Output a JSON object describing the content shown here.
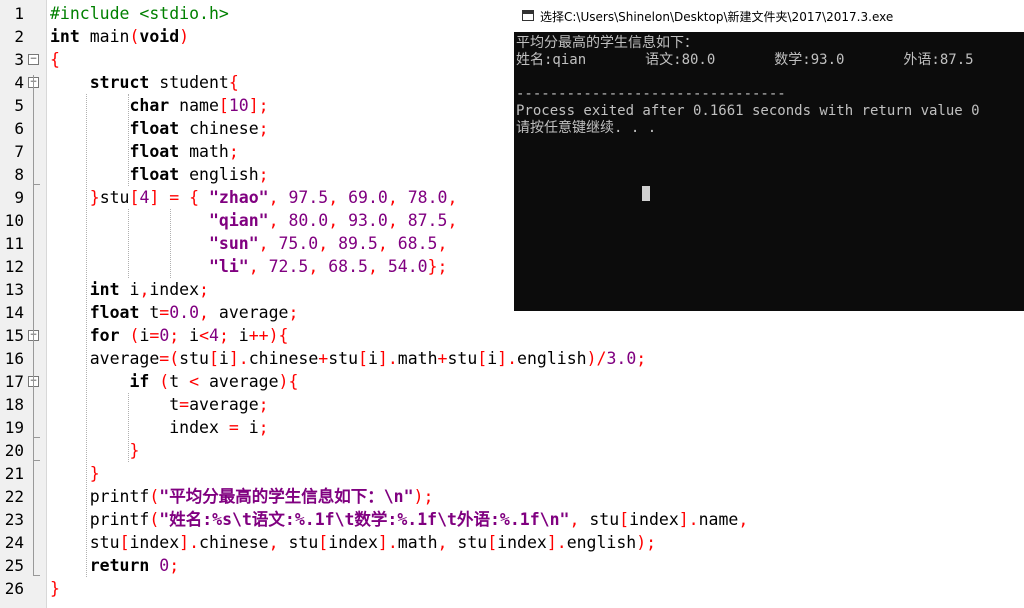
{
  "editor": {
    "line_numbers": [
      "1",
      "2",
      "3",
      "4",
      "5",
      "6",
      "7",
      "8",
      "9",
      "10",
      "11",
      "12",
      "13",
      "14",
      "15",
      "16",
      "17",
      "18",
      "19",
      "20",
      "21",
      "22",
      "23",
      "24",
      "25",
      "26"
    ],
    "lines": [
      [
        {
          "t": "#include <stdio.h>",
          "c": "pp"
        }
      ],
      [
        {
          "t": "int",
          "c": "kw"
        },
        {
          "t": " main"
        },
        {
          "t": "(",
          "c": "pn"
        },
        {
          "t": "void",
          "c": "kw"
        },
        {
          "t": ")",
          "c": "pn"
        }
      ],
      [
        {
          "t": "{",
          "c": "pn"
        }
      ],
      [
        {
          "t": "    "
        },
        {
          "t": "struct",
          "c": "kw"
        },
        {
          "t": " student"
        },
        {
          "t": "{",
          "c": "pn"
        }
      ],
      [
        {
          "t": "        "
        },
        {
          "t": "char",
          "c": "kw"
        },
        {
          "t": " name"
        },
        {
          "t": "[",
          "c": "pn"
        },
        {
          "t": "10",
          "c": "nm"
        },
        {
          "t": "];",
          "c": "pn"
        }
      ],
      [
        {
          "t": "        "
        },
        {
          "t": "float",
          "c": "kw"
        },
        {
          "t": " chinese"
        },
        {
          "t": ";",
          "c": "pn"
        }
      ],
      [
        {
          "t": "        "
        },
        {
          "t": "float",
          "c": "kw"
        },
        {
          "t": " math"
        },
        {
          "t": ";",
          "c": "pn"
        }
      ],
      [
        {
          "t": "        "
        },
        {
          "t": "float",
          "c": "kw"
        },
        {
          "t": " english"
        },
        {
          "t": ";",
          "c": "pn"
        }
      ],
      [
        {
          "t": "    "
        },
        {
          "t": "}",
          "c": "pn"
        },
        {
          "t": "stu"
        },
        {
          "t": "[",
          "c": "pn"
        },
        {
          "t": "4",
          "c": "nm"
        },
        {
          "t": "]",
          "c": "pn"
        },
        {
          "t": " "
        },
        {
          "t": "=",
          "c": "pn"
        },
        {
          "t": " "
        },
        {
          "t": "{",
          "c": "pn"
        },
        {
          "t": " "
        },
        {
          "t": "\"zhao\"",
          "c": "st"
        },
        {
          "t": ",",
          "c": "pn"
        },
        {
          "t": " "
        },
        {
          "t": "97.5",
          "c": "nm"
        },
        {
          "t": ",",
          "c": "pn"
        },
        {
          "t": " "
        },
        {
          "t": "69.0",
          "c": "nm"
        },
        {
          "t": ",",
          "c": "pn"
        },
        {
          "t": " "
        },
        {
          "t": "78.0",
          "c": "nm"
        },
        {
          "t": ",",
          "c": "pn"
        }
      ],
      [
        {
          "t": "                "
        },
        {
          "t": "\"qian\"",
          "c": "st"
        },
        {
          "t": ",",
          "c": "pn"
        },
        {
          "t": " "
        },
        {
          "t": "80.0",
          "c": "nm"
        },
        {
          "t": ",",
          "c": "pn"
        },
        {
          "t": " "
        },
        {
          "t": "93.0",
          "c": "nm"
        },
        {
          "t": ",",
          "c": "pn"
        },
        {
          "t": " "
        },
        {
          "t": "87.5",
          "c": "nm"
        },
        {
          "t": ",",
          "c": "pn"
        }
      ],
      [
        {
          "t": "                "
        },
        {
          "t": "\"sun\"",
          "c": "st"
        },
        {
          "t": ",",
          "c": "pn"
        },
        {
          "t": " "
        },
        {
          "t": "75.0",
          "c": "nm"
        },
        {
          "t": ",",
          "c": "pn"
        },
        {
          "t": " "
        },
        {
          "t": "89.5",
          "c": "nm"
        },
        {
          "t": ",",
          "c": "pn"
        },
        {
          "t": " "
        },
        {
          "t": "68.5",
          "c": "nm"
        },
        {
          "t": ",",
          "c": "pn"
        }
      ],
      [
        {
          "t": "                "
        },
        {
          "t": "\"li\"",
          "c": "st"
        },
        {
          "t": ",",
          "c": "pn"
        },
        {
          "t": " "
        },
        {
          "t": "72.5",
          "c": "nm"
        },
        {
          "t": ",",
          "c": "pn"
        },
        {
          "t": " "
        },
        {
          "t": "68.5",
          "c": "nm"
        },
        {
          "t": ",",
          "c": "pn"
        },
        {
          "t": " "
        },
        {
          "t": "54.0",
          "c": "nm"
        },
        {
          "t": "};",
          "c": "pn"
        }
      ],
      [
        {
          "t": "    "
        },
        {
          "t": "int",
          "c": "kw"
        },
        {
          "t": " i"
        },
        {
          "t": ",",
          "c": "pn"
        },
        {
          "t": "index"
        },
        {
          "t": ";",
          "c": "pn"
        }
      ],
      [
        {
          "t": "    "
        },
        {
          "t": "float",
          "c": "kw"
        },
        {
          "t": " t"
        },
        {
          "t": "=",
          "c": "pn"
        },
        {
          "t": "0.0",
          "c": "nm"
        },
        {
          "t": ",",
          "c": "pn"
        },
        {
          "t": " average"
        },
        {
          "t": ";",
          "c": "pn"
        }
      ],
      [
        {
          "t": "    "
        },
        {
          "t": "for",
          "c": "kw"
        },
        {
          "t": " "
        },
        {
          "t": "(",
          "c": "pn"
        },
        {
          "t": "i"
        },
        {
          "t": "=",
          "c": "pn"
        },
        {
          "t": "0",
          "c": "nm"
        },
        {
          "t": ";",
          "c": "pn"
        },
        {
          "t": " i"
        },
        {
          "t": "<",
          "c": "pn"
        },
        {
          "t": "4",
          "c": "nm"
        },
        {
          "t": ";",
          "c": "pn"
        },
        {
          "t": " i"
        },
        {
          "t": "++){",
          "c": "pn"
        }
      ],
      [
        {
          "t": "    "
        },
        {
          "t": "average"
        },
        {
          "t": "=(",
          "c": "pn"
        },
        {
          "t": "stu"
        },
        {
          "t": "[",
          "c": "pn"
        },
        {
          "t": "i"
        },
        {
          "t": "].",
          "c": "pn"
        },
        {
          "t": "chinese"
        },
        {
          "t": "+",
          "c": "pn"
        },
        {
          "t": "stu"
        },
        {
          "t": "[",
          "c": "pn"
        },
        {
          "t": "i"
        },
        {
          "t": "].",
          "c": "pn"
        },
        {
          "t": "math"
        },
        {
          "t": "+",
          "c": "pn"
        },
        {
          "t": "stu"
        },
        {
          "t": "[",
          "c": "pn"
        },
        {
          "t": "i"
        },
        {
          "t": "].",
          "c": "pn"
        },
        {
          "t": "english"
        },
        {
          "t": ")/",
          "c": "pn"
        },
        {
          "t": "3.0",
          "c": "nm"
        },
        {
          "t": ";",
          "c": "pn"
        }
      ],
      [
        {
          "t": "        "
        },
        {
          "t": "if",
          "c": "kw"
        },
        {
          "t": " "
        },
        {
          "t": "(",
          "c": "pn"
        },
        {
          "t": "t "
        },
        {
          "t": "<",
          "c": "pn"
        },
        {
          "t": " average"
        },
        {
          "t": "){",
          "c": "pn"
        }
      ],
      [
        {
          "t": "            "
        },
        {
          "t": "t"
        },
        {
          "t": "=",
          "c": "pn"
        },
        {
          "t": "average"
        },
        {
          "t": ";",
          "c": "pn"
        }
      ],
      [
        {
          "t": "            "
        },
        {
          "t": "index "
        },
        {
          "t": "=",
          "c": "pn"
        },
        {
          "t": " i"
        },
        {
          "t": ";",
          "c": "pn"
        }
      ],
      [
        {
          "t": "        "
        },
        {
          "t": "}",
          "c": "pn"
        }
      ],
      [
        {
          "t": "    "
        },
        {
          "t": "}",
          "c": "pn"
        }
      ],
      [
        {
          "t": "    "
        },
        {
          "t": "printf"
        },
        {
          "t": "(",
          "c": "pn"
        },
        {
          "t": "\"平均分最高的学生信息如下：\\n\"",
          "c": "st"
        },
        {
          "t": ");",
          "c": "pn"
        }
      ],
      [
        {
          "t": "    "
        },
        {
          "t": "printf"
        },
        {
          "t": "(",
          "c": "pn"
        },
        {
          "t": "\"姓名:%s\\t语文:%.1f\\t数学:%.1f\\t外语:%.1f\\n\"",
          "c": "st"
        },
        {
          "t": ",",
          "c": "pn"
        },
        {
          "t": " stu"
        },
        {
          "t": "[",
          "c": "pn"
        },
        {
          "t": "index"
        },
        {
          "t": "].",
          "c": "pn"
        },
        {
          "t": "name"
        },
        {
          "t": ",",
          "c": "pn"
        }
      ],
      [
        {
          "t": "    "
        },
        {
          "t": "stu"
        },
        {
          "t": "[",
          "c": "pn"
        },
        {
          "t": "index"
        },
        {
          "t": "].",
          "c": "pn"
        },
        {
          "t": "chinese"
        },
        {
          "t": ",",
          "c": "pn"
        },
        {
          "t": " stu"
        },
        {
          "t": "[",
          "c": "pn"
        },
        {
          "t": "index"
        },
        {
          "t": "].",
          "c": "pn"
        },
        {
          "t": "math"
        },
        {
          "t": ",",
          "c": "pn"
        },
        {
          "t": " stu"
        },
        {
          "t": "[",
          "c": "pn"
        },
        {
          "t": "index"
        },
        {
          "t": "].",
          "c": "pn"
        },
        {
          "t": "english"
        },
        {
          "t": ");",
          "c": "pn"
        }
      ],
      [
        {
          "t": "    "
        },
        {
          "t": "return",
          "c": "kw"
        },
        {
          "t": " "
        },
        {
          "t": "0",
          "c": "nm"
        },
        {
          "t": ";",
          "c": "pn"
        }
      ],
      [
        {
          "t": "}",
          "c": "pn"
        }
      ]
    ],
    "fold_markers": [
      "⊟",
      "⊟",
      "⊟",
      "⊟",
      "⊟"
    ],
    "colors": {
      "keyword": "#000000",
      "string": "#800080",
      "number": "#800080",
      "punct": "#ff0000",
      "preprocessor": "#008000",
      "gutter": "#f0f0f0"
    }
  },
  "console": {
    "title": "选择C:\\Users\\Shinelon\\Desktop\\新建文件夹\\2017\\2017.3.exe",
    "icon": "console-window-icon",
    "lines": [
      "平均分最高的学生信息如下：",
      "姓名:qian       语文:80.0       数学:93.0       外语:87.5",
      "",
      "--------------------------------",
      "Process exited after 0.1661 seconds with return value 0",
      "请按任意键继续. . ."
    ],
    "colors": {
      "background": "#0c0c0c",
      "text": "#c0c0c0"
    }
  }
}
